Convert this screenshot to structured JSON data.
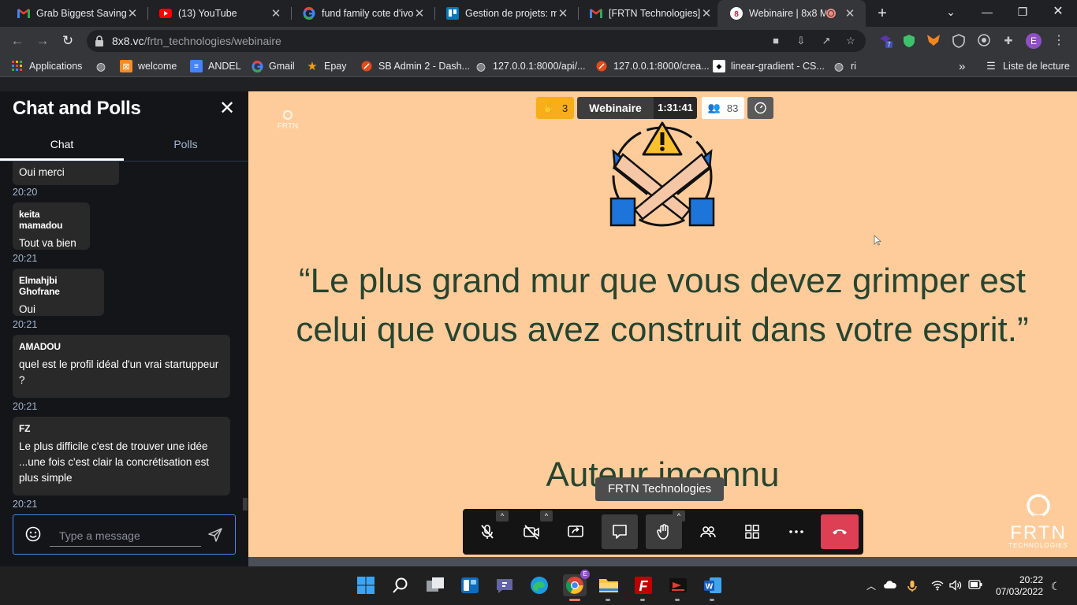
{
  "browser": {
    "tabs": [
      {
        "title": "Grab Biggest Savings o",
        "icon": "gmail-icon"
      },
      {
        "title": "(13) YouTube",
        "icon": "youtube-icon"
      },
      {
        "title": "fund family cote d'ivoi",
        "icon": "google-icon"
      },
      {
        "title": "Gestion de projets: mé",
        "icon": "trello-icon"
      },
      {
        "title": "[FRTN Technologies] N",
        "icon": "gmail-icon"
      },
      {
        "title": "Webinaire | 8x8 M",
        "icon": "8x8-icon"
      }
    ],
    "url_host": "8x8.vc",
    "url_path": "/frtn_technologies/webinaire",
    "extension_badge": "7",
    "profile_initial": "E",
    "bookmarks": [
      {
        "label": "Applications",
        "icon": "apps-grid-icon"
      },
      {
        "label": "",
        "icon": "globe-icon"
      },
      {
        "label": "welcome",
        "icon": "xampp-icon"
      },
      {
        "label": "ANDEL",
        "icon": "doc-icon"
      },
      {
        "label": "Gmail",
        "icon": "google-icon"
      },
      {
        "label": "Epay",
        "icon": "star-icon"
      },
      {
        "label": "SB Admin 2 - Dash...",
        "icon": "laravel-icon"
      },
      {
        "label": "127.0.0.1:8000/api/...",
        "icon": "globe-icon"
      },
      {
        "label": "127.0.0.1:8000/crea...",
        "icon": "laravel-icon"
      },
      {
        "label": "linear-gradient - CS...",
        "icon": "mdn-icon"
      },
      {
        "label": "ri",
        "icon": "globe-icon"
      }
    ],
    "reading_list": "Liste de lecture",
    "overflow": "»"
  },
  "chat": {
    "title": "Chat and Polls",
    "tabs": [
      "Chat",
      "Polls"
    ],
    "messages": [
      {
        "author": "",
        "text": "Oui merci",
        "time": "20:20"
      },
      {
        "author": "keita mamadou",
        "text": "Tout va bien",
        "time": "20:21"
      },
      {
        "author": "Elmahjbi Ghofrane",
        "text": "Oui",
        "time": "20:21"
      },
      {
        "author": "AMADOU",
        "text": "quel est le profil idéal d'un vrai startuppeur ?",
        "time": "20:21"
      },
      {
        "author": "FZ",
        "text": "Le plus difficile c'est de trouver une idée ...une fois c'est clair la concrétisation est plus simple",
        "time": "20:21"
      }
    ],
    "input_placeholder": "Type a message"
  },
  "meeting": {
    "raised_hands": "3",
    "session_name": "Webinaire",
    "timer": "1:31:41",
    "participants": "83",
    "quote": "“Le plus grand mur que vous devez grimper est celui que vous avez construit dans votre esprit.”",
    "author": "Auteur inconnu",
    "speaker": "FRTN Technologies",
    "logo_text": "FRTN",
    "logo_subtext": "TECHNOLOGIES",
    "colors": {
      "slide_bg": "#fecc9a",
      "quote": "#264531",
      "hangup": "#dd3f54",
      "raise_hand": "#f8ae1a"
    }
  },
  "taskbar": {
    "time": "20:22",
    "date": "07/03/2022"
  }
}
